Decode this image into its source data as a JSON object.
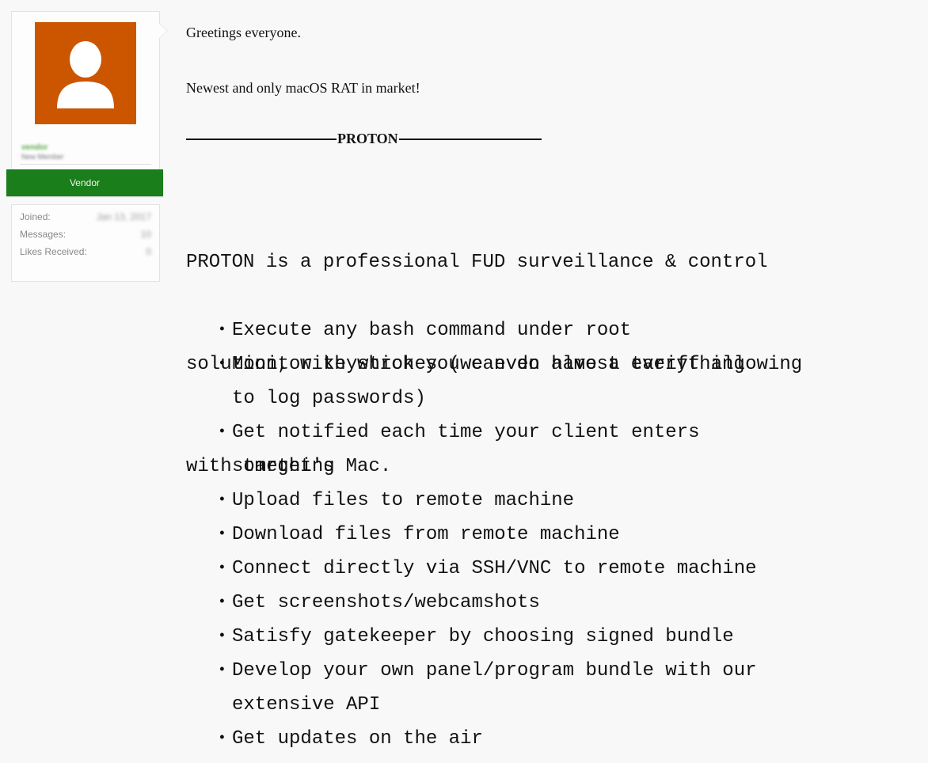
{
  "user_panel": {
    "username": "vendor",
    "user_title": "New Member",
    "banner": "Vendor",
    "stats": [
      {
        "label": "Joined:",
        "value": "Jan 13, 2017"
      },
      {
        "label": "Messages:",
        "value": "10"
      },
      {
        "label": "Likes Received:",
        "value": "0"
      }
    ],
    "avatar_color": "#cc5500",
    "banner_color": "#1a7e1a"
  },
  "post": {
    "greeting": "Greetings everyone.",
    "headline": "Newest and only macOS RAT in market!",
    "section_title": "PROTON",
    "intro_lines": [
      "PROTON is a professional FUD surveillance & control",
      "solution, with which you can do almost everything",
      "with target's Mac."
    ],
    "features": [
      "Execute any bash command under root",
      "Monitor keystrokes (we even have a tariff allowing\nto log passwords)",
      "Get notified each time your client enters\nsomething",
      "Upload files to remote machine",
      "Download files from remote machine",
      "Connect directly via SSH/VNC to remote machine",
      "Get screenshots/webcamshots",
      "Satisfy gatekeeper by choosing signed bundle",
      "Develop your own panel/program bundle with our\nextensive API",
      "Get updates on the air"
    ]
  }
}
